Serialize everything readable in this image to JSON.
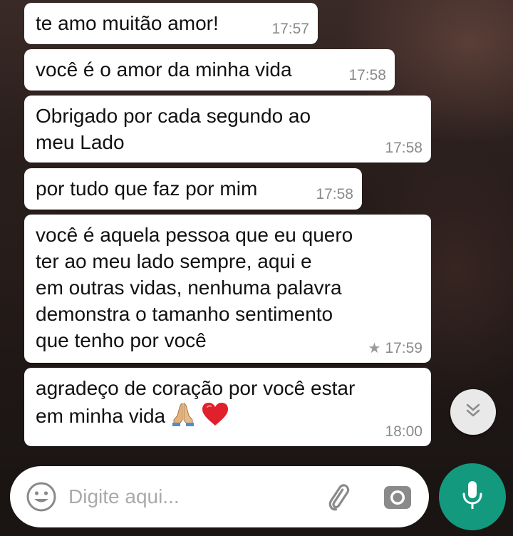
{
  "messages": [
    {
      "text": "te amo muitão amor!",
      "time": "17:57",
      "starred": false
    },
    {
      "text": "você é o amor da minha vida",
      "time": "17:58",
      "starred": false
    },
    {
      "text": "Obrigado por cada segundo ao\nmeu Lado",
      "time": "17:58",
      "starred": false
    },
    {
      "text": "por tudo que faz por mim",
      "time": "17:58",
      "starred": false
    },
    {
      "text": "você é aquela pessoa que eu quero\nter ao meu lado sempre, aqui e\nem outras vidas, nenhuma palavra\ndemonstra o tamanho sentimento\nque tenho por você",
      "time": "17:59",
      "starred": true
    },
    {
      "text": "agradeço de coração por você estar\nem minha vida",
      "time": "18:00",
      "starred": false,
      "emojis": [
        "folded-hands-icon",
        "red-heart-icon"
      ]
    }
  ],
  "composer": {
    "placeholder": "Digite aqui...",
    "emoji_icon": "smiley-icon",
    "attach_icon": "paperclip-icon",
    "camera_icon": "camera-icon"
  },
  "mic_button": {
    "icon": "microphone-icon",
    "color": "#139a7e"
  },
  "scroll_button": {
    "icon": "double-chevron-down-icon"
  },
  "colors": {
    "bubble": "#ffffff",
    "time_text": "#8a8a8a",
    "accent": "#139a7e"
  }
}
